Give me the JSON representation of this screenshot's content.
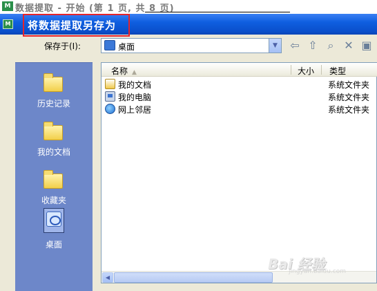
{
  "background_window": {
    "title": "数据提取 - 开始 (第 1 页, 共 8 页)"
  },
  "dialog": {
    "title": "将数据提取另存为",
    "save_in_label": "保存于(I):",
    "location": "桌面",
    "toolbar": [
      "back-icon",
      "up-folder-icon",
      "search-web-icon",
      "delete-icon",
      "new-folder-icon"
    ]
  },
  "places": [
    {
      "label": "历史记录",
      "icon": "history-folder-icon"
    },
    {
      "label": "我的文档",
      "icon": "my-documents-icon"
    },
    {
      "label": "收藏夹",
      "icon": "favorites-folder-icon"
    },
    {
      "label": "桌面",
      "icon": "desktop-icon",
      "selected": true
    }
  ],
  "file_list": {
    "columns": {
      "name": "名称",
      "size": "大小",
      "type": "类型"
    },
    "rows": [
      {
        "name": "我的文档",
        "type": "系统文件夹",
        "icon": "my-documents-icon"
      },
      {
        "name": "我的电脑",
        "type": "系统文件夹",
        "icon": "my-computer-icon"
      },
      {
        "name": "网上邻居",
        "type": "系统文件夹",
        "icon": "network-places-icon"
      }
    ]
  },
  "watermark": {
    "text": "Bai 经验",
    "sub": "jingyan.baidu.com"
  }
}
